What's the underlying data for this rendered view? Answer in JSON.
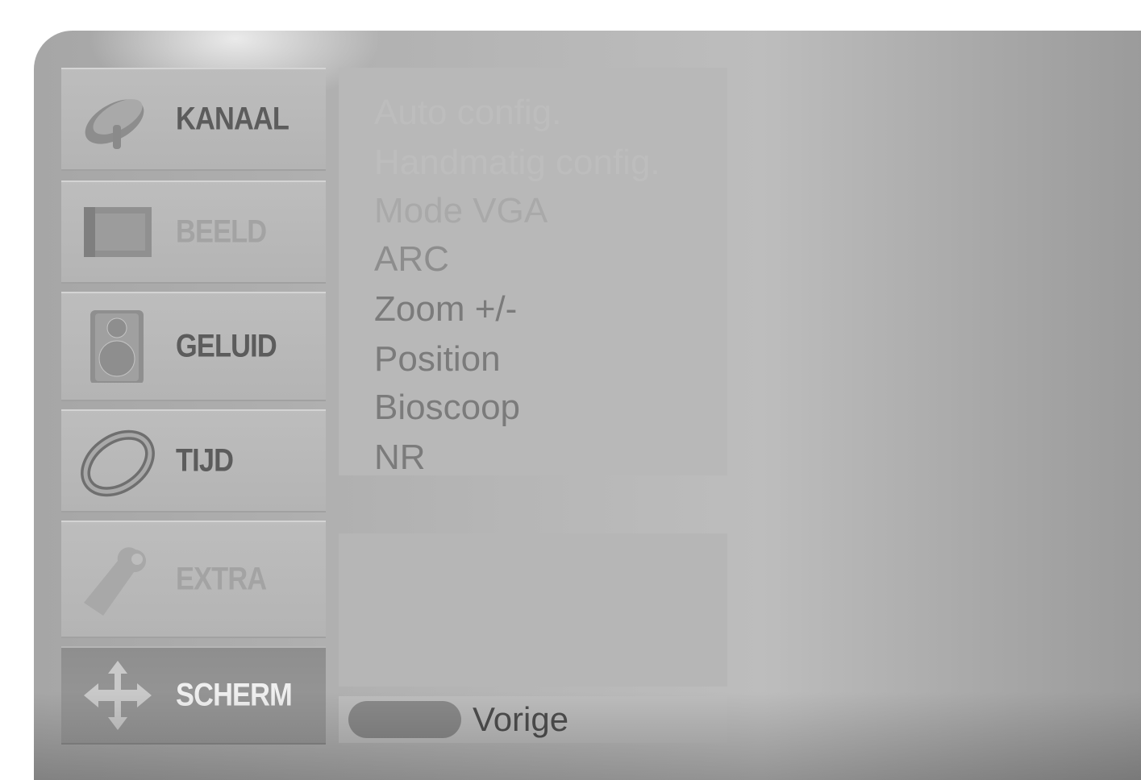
{
  "sidebar": {
    "items": [
      {
        "label": "KANAAL",
        "icon": "satellite-dish-icon"
      },
      {
        "label": "BEELD",
        "icon": "film-icon"
      },
      {
        "label": "GELUID",
        "icon": "speaker-icon"
      },
      {
        "label": "TIJD",
        "icon": "clock-ring-icon"
      },
      {
        "label": "EXTRA",
        "icon": "tag-icon"
      },
      {
        "label": "SCHERM",
        "icon": "move-arrows-icon",
        "selected": true
      }
    ]
  },
  "submenu": {
    "items": [
      {
        "label": "Auto config."
      },
      {
        "label": "Handmatig config."
      },
      {
        "label": "Mode VGA"
      },
      {
        "label": "ARC"
      },
      {
        "label": "Zoom +/-"
      },
      {
        "label": "Position"
      },
      {
        "label": "Bioscoop"
      },
      {
        "label": "NR"
      }
    ]
  },
  "help": {
    "back_label": "Vorige"
  },
  "colors": {
    "frame": "#b4b4b4",
    "panel": "#b8b8b8",
    "selected_item": "#929292",
    "text": "#5c5c5c"
  }
}
